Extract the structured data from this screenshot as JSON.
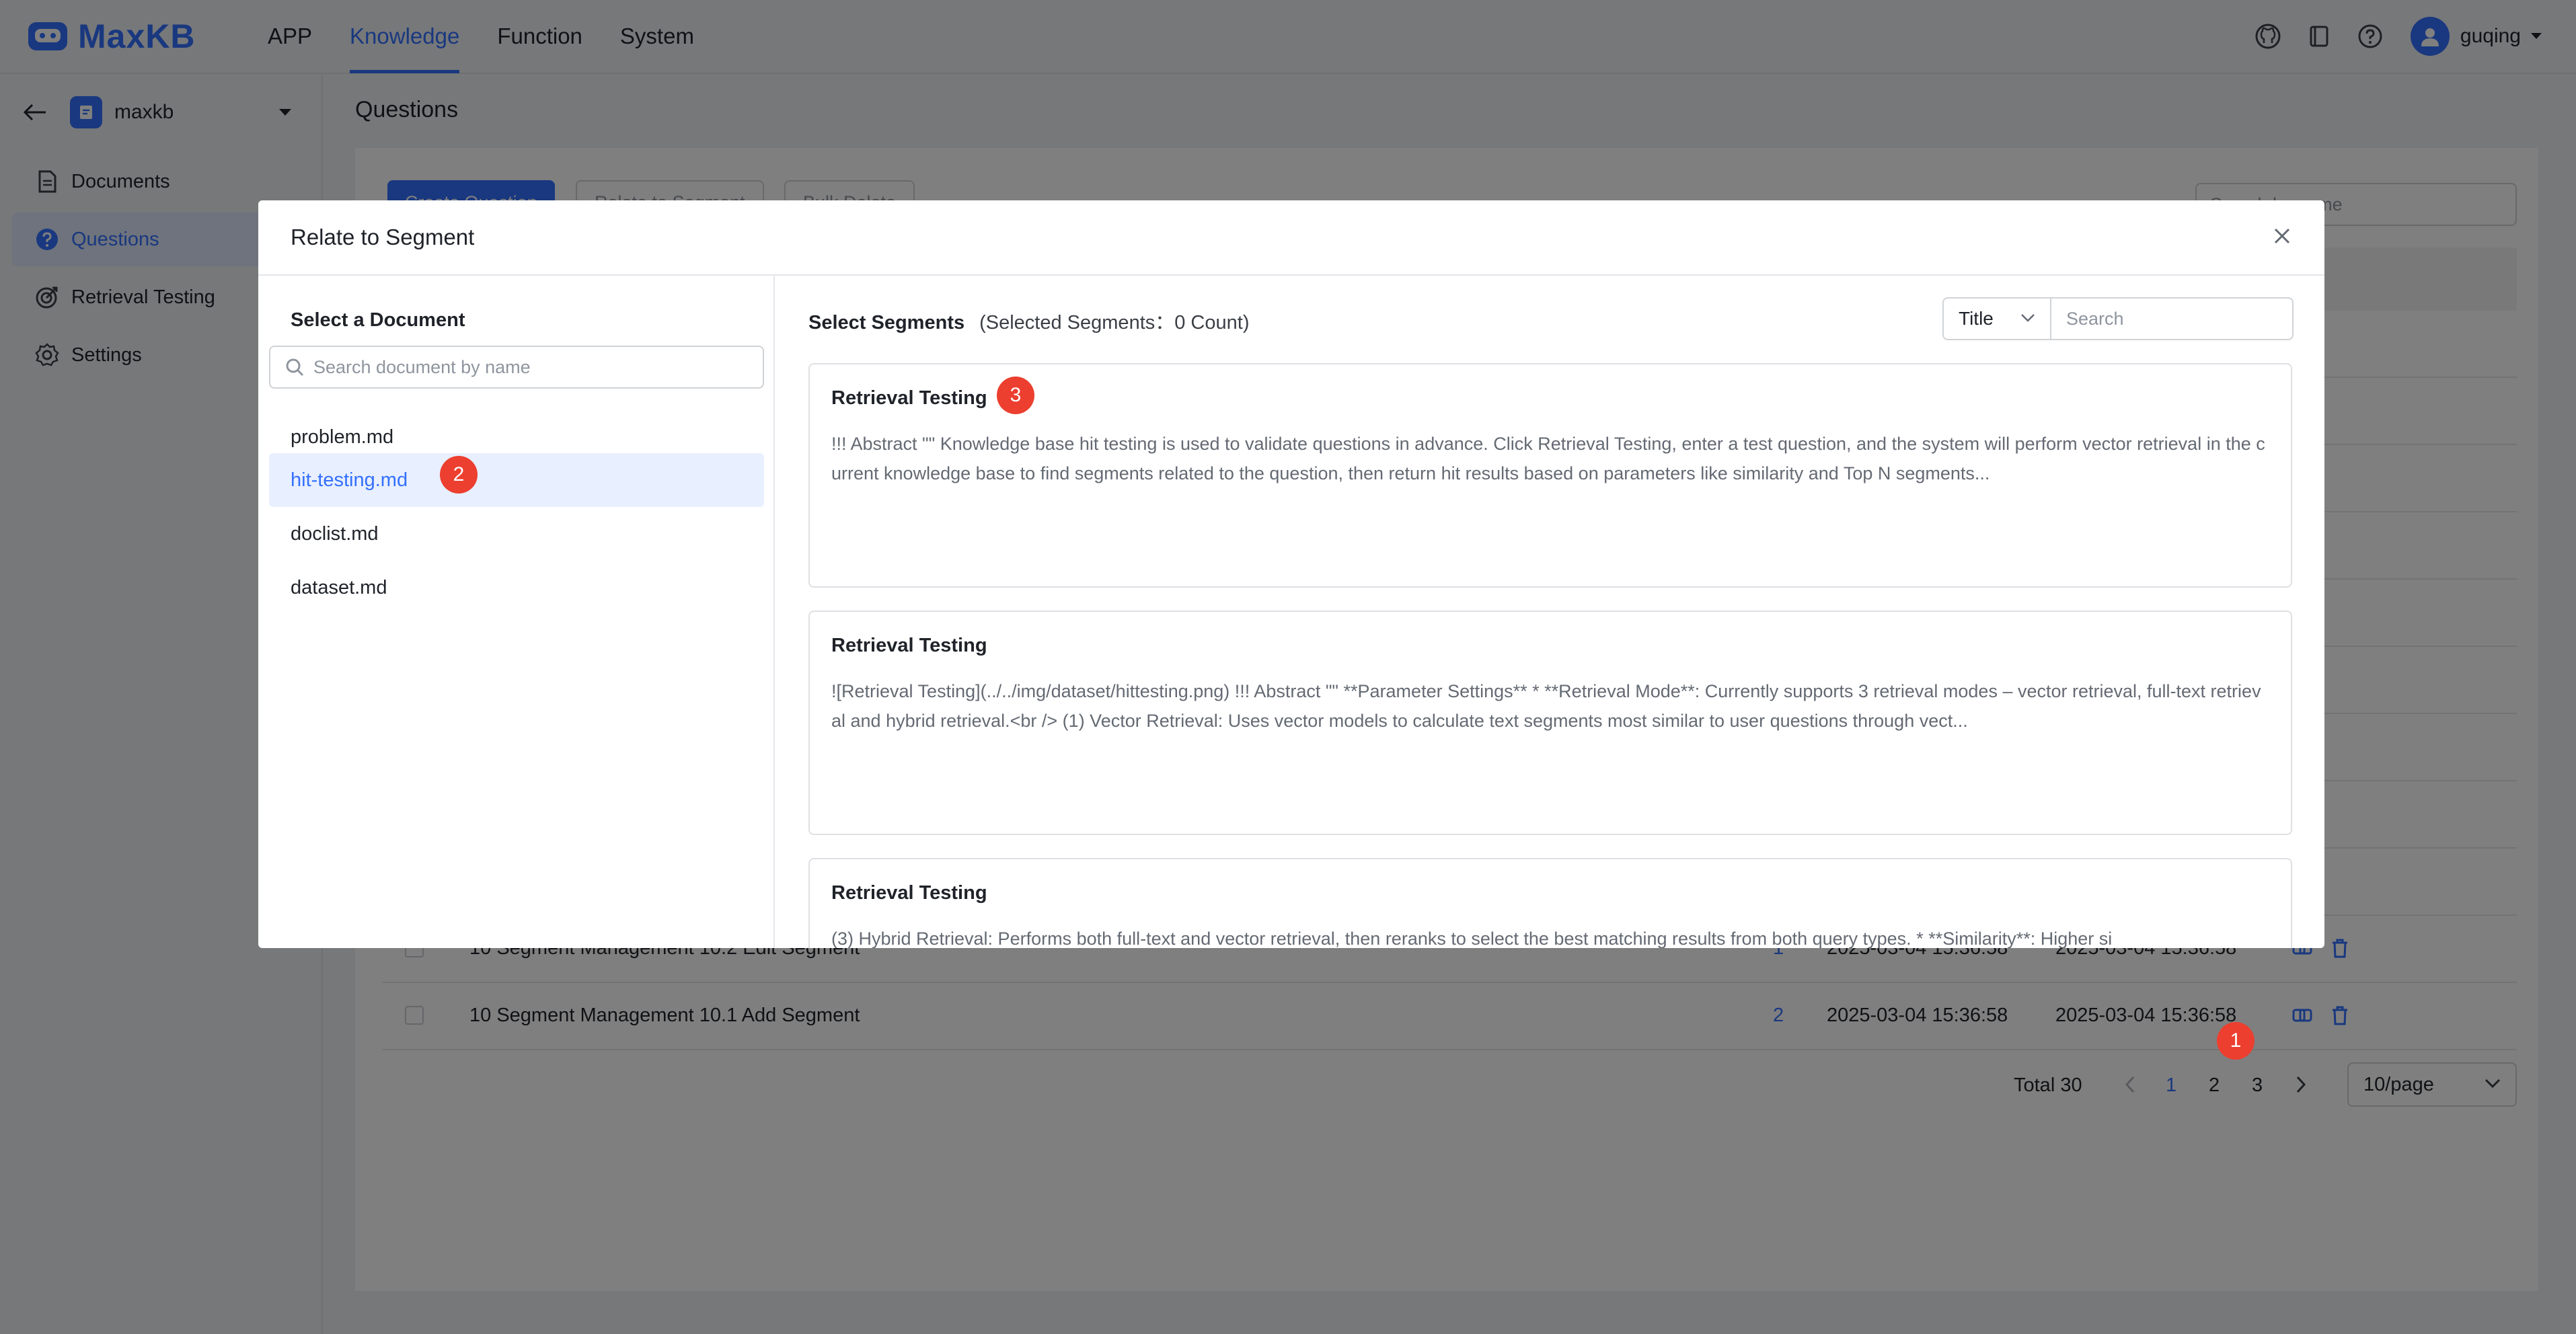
{
  "brand": {
    "name": "MaxKB"
  },
  "nav": {
    "items": [
      "APP",
      "Knowledge",
      "Function",
      "System"
    ],
    "active": "Knowledge"
  },
  "header": {
    "user": "guqing"
  },
  "sidebar": {
    "kb_name": "maxkb",
    "items": [
      {
        "label": "Documents",
        "icon": "document-icon"
      },
      {
        "label": "Questions",
        "icon": "question-icon"
      },
      {
        "label": "Retrieval Testing",
        "icon": "target-icon"
      },
      {
        "label": "Settings",
        "icon": "gear-icon"
      }
    ],
    "active": "Questions"
  },
  "main": {
    "title": "Questions",
    "buttons": {
      "create": "Create Question",
      "relate": "Relate to Segment",
      "bulk_delete": "Bulk Delete"
    },
    "search_placeholder": "Search by name",
    "rows": [
      {
        "title": "10 Segment Management 10.2 Edit Segment",
        "count": "1",
        "created": "2025-03-04 15:36:58",
        "updated": "2025-03-04 15:36:58"
      },
      {
        "title": "10 Segment Management 10.1 Add Segment",
        "count": "2",
        "created": "2025-03-04 15:36:58",
        "updated": "2025-03-04 15:36:58"
      }
    ],
    "pagination": {
      "total": "Total 30",
      "pages": [
        "1",
        "2",
        "3"
      ],
      "current": "1",
      "page_size": "10/page"
    }
  },
  "dialog": {
    "title": "Relate to Segment",
    "left_label": "Select a Document",
    "doc_search_placeholder": "Search document by name",
    "documents": [
      "problem.md",
      "hit-testing.md",
      "doclist.md",
      "dataset.md"
    ],
    "active_document": "hit-testing.md",
    "right_label": "Select Segments",
    "selected_info": "(Selected Segments：0 Count)",
    "filter": {
      "selected": "Title",
      "placeholder": "Search"
    },
    "segments": [
      {
        "title": "Retrieval Testing",
        "text": "!!! Abstract \"\" Knowledge base hit testing is used to validate questions in advance. Click Retrieval Testing, enter a test question, and the system will perform vector retrieval in the current knowledge base to find segments related to the question, then return hit results based on parameters like similarity and Top N segments..."
      },
      {
        "title": "Retrieval Testing",
        "text": "![Retrieval Testing](../../img/dataset/hittesting.png) !!! Abstract \"\" **Parameter Settings** * **Retrieval Mode**: Currently supports 3 retrieval modes – vector retrieval, full-text retrieval and hybrid retrieval.<br /> (1) Vector Retrieval: Uses vector models to calculate text segments most similar to user questions through vect..."
      },
      {
        "title": "Retrieval Testing",
        "text": "(3) Hybrid Retrieval: Performs both full-text and vector retrieval, then reranks to select the best matching results from both query types. * **Similarity**: Higher si"
      }
    ]
  },
  "annotations": [
    "1",
    "2",
    "3"
  ],
  "colors": {
    "accent": "#3370ff",
    "badge": "#ec3f2f"
  }
}
